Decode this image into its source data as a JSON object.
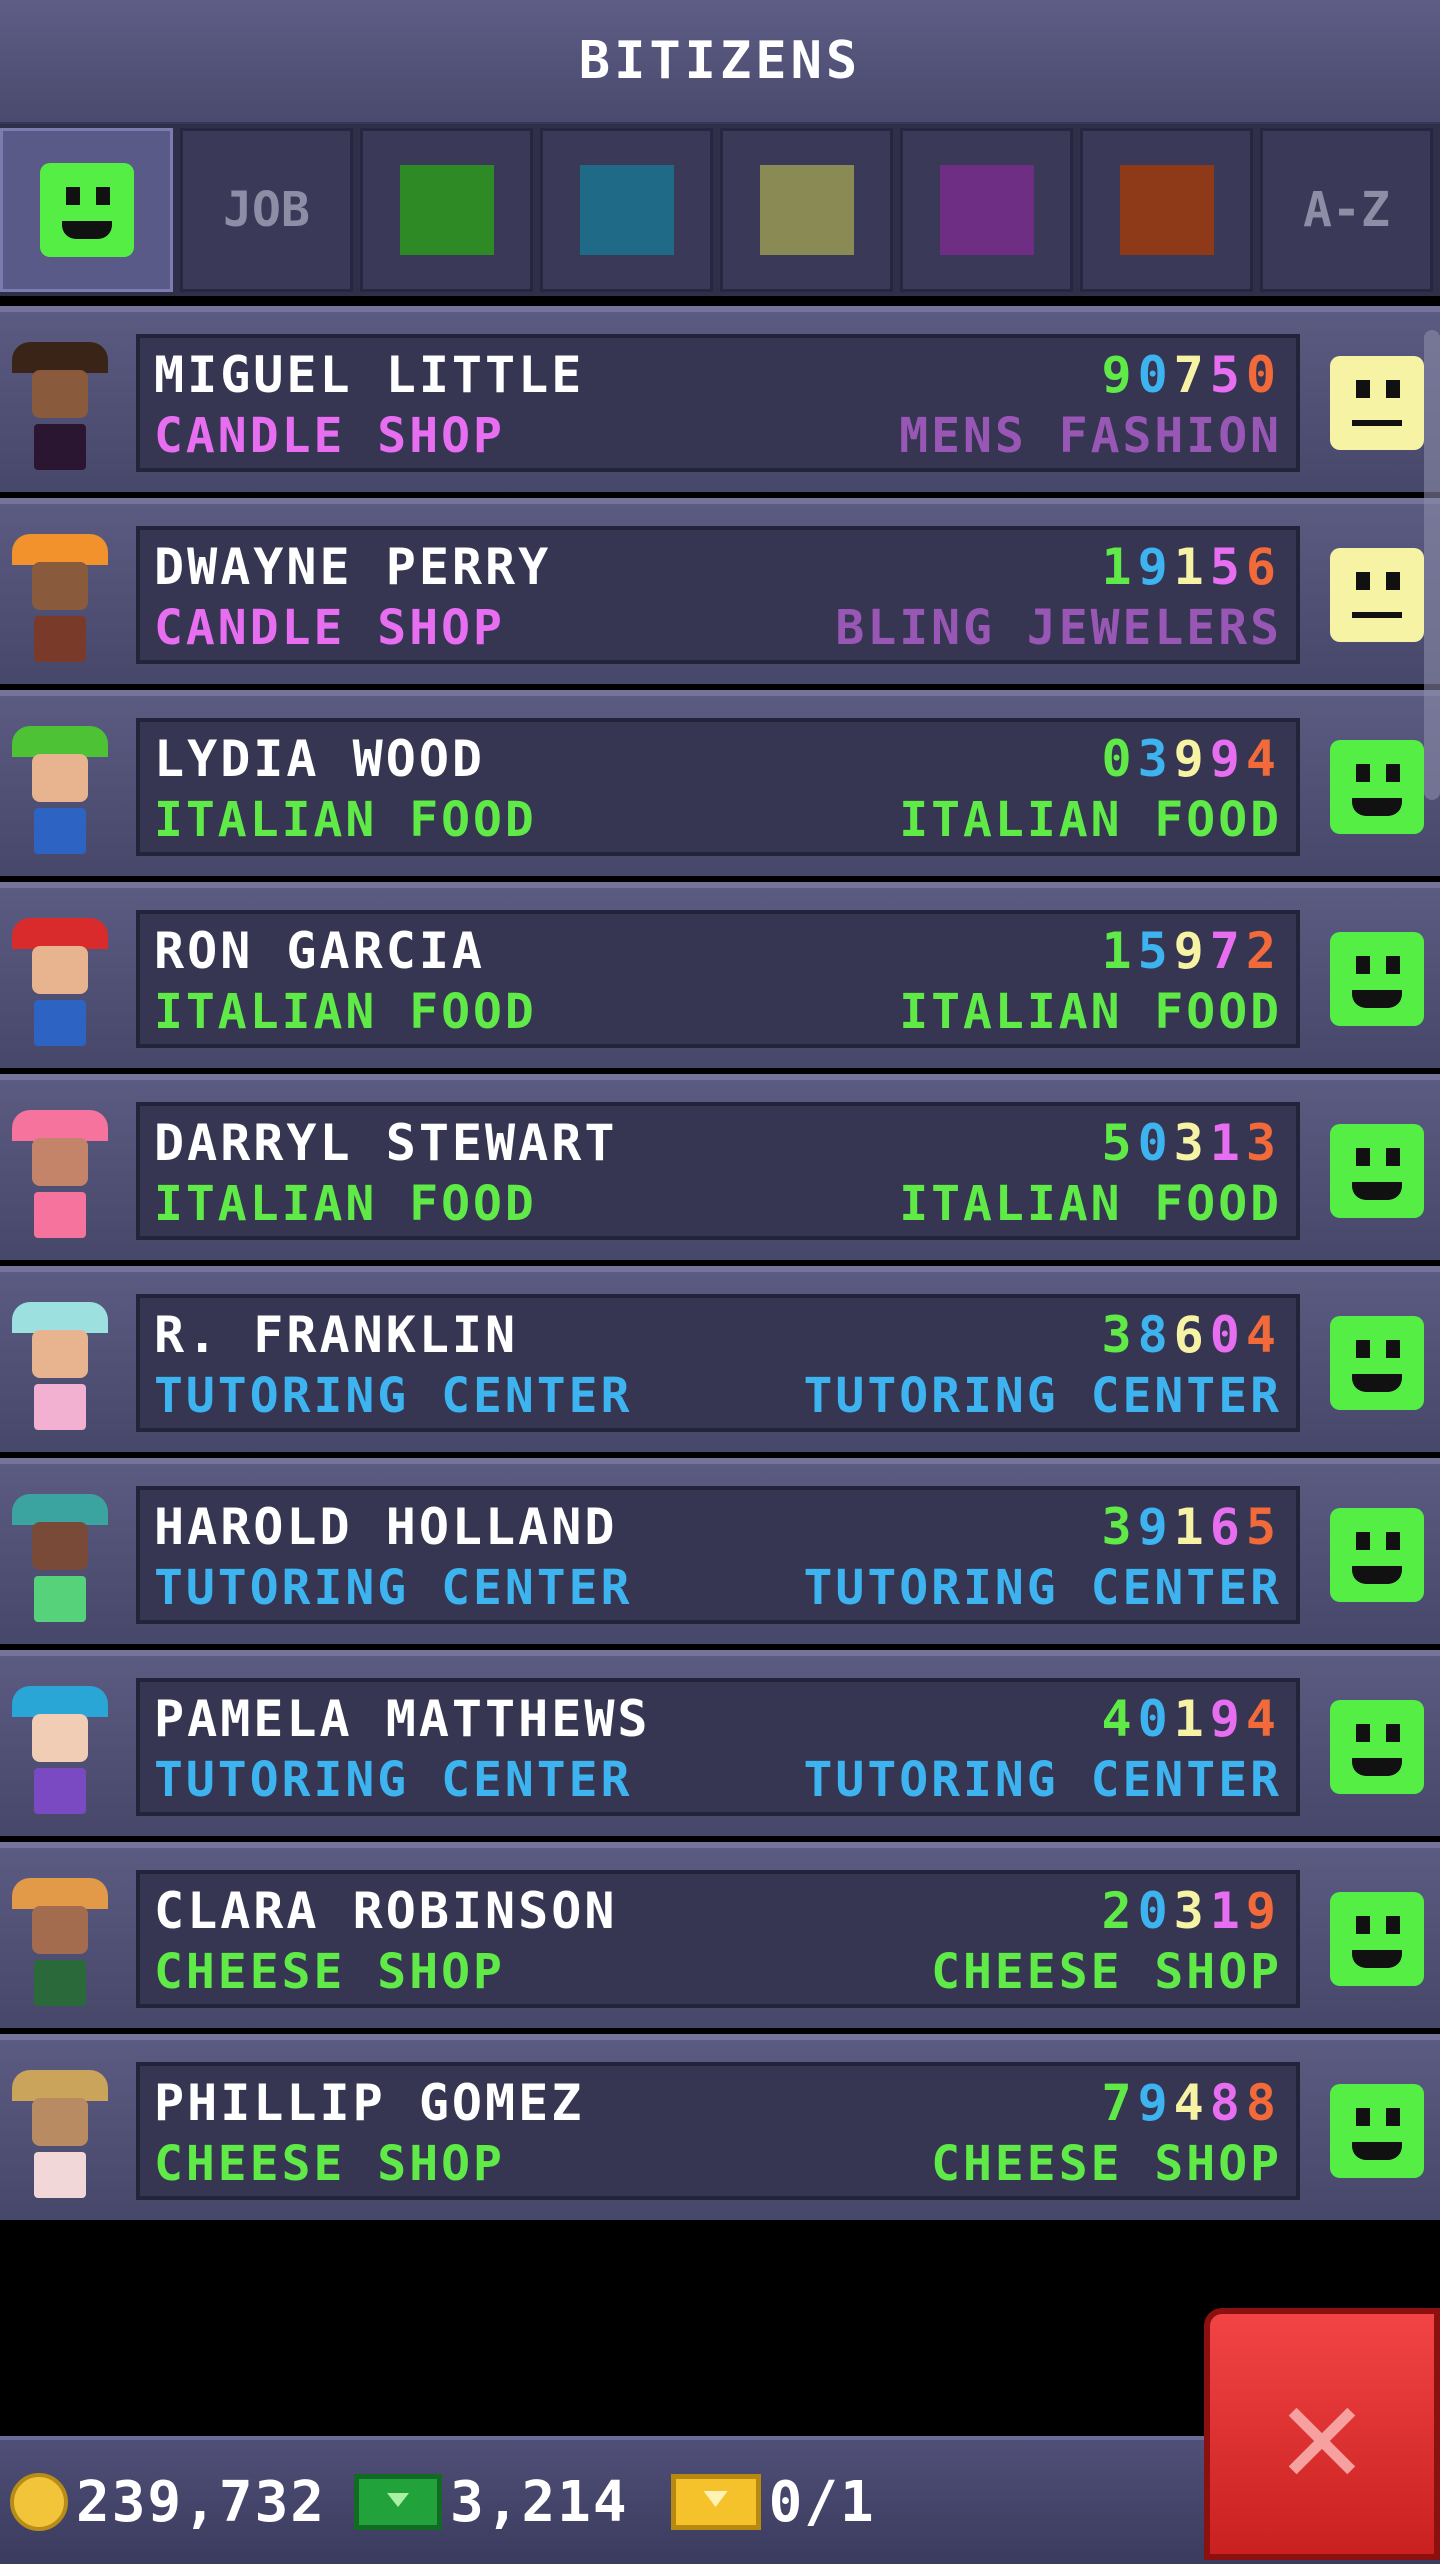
{
  "title": "BITIZENS",
  "tabs": [
    {
      "kind": "mood"
    },
    {
      "kind": "text",
      "label": "JOB"
    },
    {
      "kind": "color",
      "color": "#2e8a25"
    },
    {
      "kind": "color",
      "color": "#1f6a86"
    },
    {
      "kind": "color",
      "color": "#8a8a55"
    },
    {
      "kind": "color",
      "color": "#6e2e84"
    },
    {
      "kind": "color",
      "color": "#8e3a19"
    },
    {
      "kind": "text",
      "label": "A-Z"
    }
  ],
  "rows": [
    {
      "name": "MIGUEL LITTLE",
      "digits": [
        "9",
        "0",
        "7",
        "5",
        "0"
      ],
      "job": "CANDLE SHOP",
      "dream": "MENS FASHION",
      "job_color": "#e76ef0",
      "dream_color": "#9957b5",
      "mood": "neutral",
      "skin": "#8a5a3c",
      "shirt": "#2a1630",
      "hat": "#3a2418"
    },
    {
      "name": "DWAYNE PERRY",
      "digits": [
        "1",
        "9",
        "1",
        "5",
        "6"
      ],
      "job": "CANDLE SHOP",
      "dream": "BLING JEWELERS",
      "job_color": "#e76ef0",
      "dream_color": "#9957b5",
      "mood": "neutral",
      "skin": "#8a5a3c",
      "shirt": "#7a3a2a",
      "hat": "#f2922c"
    },
    {
      "name": "LYDIA WOOD",
      "digits": [
        "0",
        "3",
        "9",
        "9",
        "4"
      ],
      "job": "ITALIAN FOOD",
      "dream": "ITALIAN FOOD",
      "job_color": "#5fea47",
      "dream_color": "#5fea47",
      "mood": "happy",
      "skin": "#e8b48f",
      "shirt": "#2d63c2",
      "hat": "#4cc234"
    },
    {
      "name": "RON GARCIA",
      "digits": [
        "1",
        "5",
        "9",
        "7",
        "2"
      ],
      "job": "ITALIAN FOOD",
      "dream": "ITALIAN FOOD",
      "job_color": "#5fea47",
      "dream_color": "#5fea47",
      "mood": "happy",
      "skin": "#e8b48f",
      "shirt": "#2d63c2",
      "hat": "#d92b2b"
    },
    {
      "name": "DARRYL STEWART",
      "digits": [
        "5",
        "0",
        "3",
        "1",
        "3"
      ],
      "job": "ITALIAN FOOD",
      "dream": "ITALIAN FOOD",
      "job_color": "#5fea47",
      "dream_color": "#5fea47",
      "mood": "happy",
      "skin": "#c4846a",
      "shirt": "#f5739c",
      "hat": "#f5739c"
    },
    {
      "name": "R. FRANKLIN",
      "digits": [
        "3",
        "8",
        "6",
        "0",
        "4"
      ],
      "job": "TUTORING CENTER",
      "dream": "TUTORING CENTER",
      "job_color": "#3db4ef",
      "dream_color": "#3db4ef",
      "mood": "happy",
      "skin": "#e8b48f",
      "shirt": "#f3b1d2",
      "hat": "#9ce0e0"
    },
    {
      "name": "HAROLD HOLLAND",
      "digits": [
        "3",
        "9",
        "1",
        "6",
        "5"
      ],
      "job": "TUTORING CENTER",
      "dream": "TUTORING CENTER",
      "job_color": "#3db4ef",
      "dream_color": "#3db4ef",
      "mood": "happy",
      "skin": "#7a4a38",
      "shirt": "#55d27a",
      "hat": "#3ca4a0"
    },
    {
      "name": "PAMELA MATTHEWS",
      "digits": [
        "4",
        "0",
        "1",
        "9",
        "4"
      ],
      "job": "TUTORING CENTER",
      "dream": "TUTORING CENTER",
      "job_color": "#3db4ef",
      "dream_color": "#3db4ef",
      "mood": "happy",
      "skin": "#f0cdb4",
      "shirt": "#7a4ac2",
      "hat": "#29a5d6"
    },
    {
      "name": "CLARA ROBINSON",
      "digits": [
        "2",
        "0",
        "3",
        "1",
        "9"
      ],
      "job": "CHEESE SHOP",
      "dream": "CHEESE SHOP",
      "job_color": "#5fea47",
      "dream_color": "#5fea47",
      "mood": "happy",
      "skin": "#a36c4e",
      "shirt": "#2a6a3a",
      "hat": "#e39a48"
    },
    {
      "name": "PHILLIP GOMEZ",
      "digits": [
        "7",
        "9",
        "4",
        "8",
        "8"
      ],
      "job": "CHEESE SHOP",
      "dream": "CHEESE SHOP",
      "job_color": "#5fea47",
      "dream_color": "#5fea47",
      "mood": "happy",
      "skin": "#b88b62",
      "shirt": "#f1d7d7",
      "hat": "#c9a45a"
    }
  ],
  "digit_colors": [
    "#5fea47",
    "#3db4ef",
    "#f6f3a4",
    "#e76ef0",
    "#f26a3a"
  ],
  "footer": {
    "coins": "239,732",
    "bux": "3,214",
    "tickets": "0/1"
  },
  "icons": {
    "coin": "coin-icon",
    "bux": "bux-icon",
    "ticket": "ticket-icon",
    "close": "close-icon"
  }
}
